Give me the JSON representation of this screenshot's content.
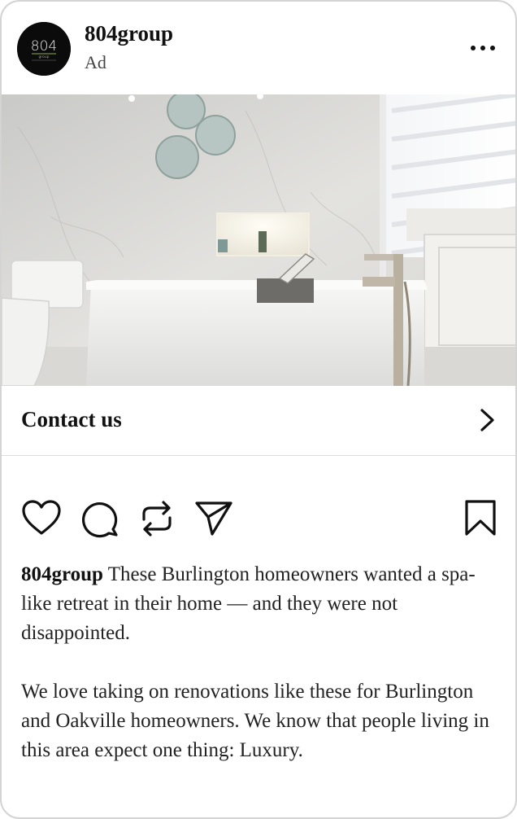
{
  "post": {
    "account": "804group",
    "sponsored_label": "Ad",
    "avatar_logo_text": "804",
    "avatar_logo_sub": "group",
    "more_icon": "more-horizontal-icon"
  },
  "media": {
    "alt": "Bathroom with freestanding white bathtub, marble walls and lit wall niche"
  },
  "cta": {
    "label": "Contact us",
    "icon": "chevron-right-icon"
  },
  "actions": {
    "like_icon": "heart-icon",
    "comment_icon": "comment-icon",
    "repost_icon": "repost-icon",
    "share_icon": "send-icon",
    "save_icon": "bookmark-icon"
  },
  "caption": {
    "username": "804group",
    "paragraph1": " These Burlington homeowners wanted a spa-like retreat in their home — and they were not disappointed.",
    "paragraph2": "We love taking on renovations like these for Burlington and Oakville homeowners. We know that people living in this area expect one thing: Luxury."
  },
  "colors": {
    "text": "#111111",
    "border": "#d4d4d4",
    "divider": "#dcdcdc"
  }
}
